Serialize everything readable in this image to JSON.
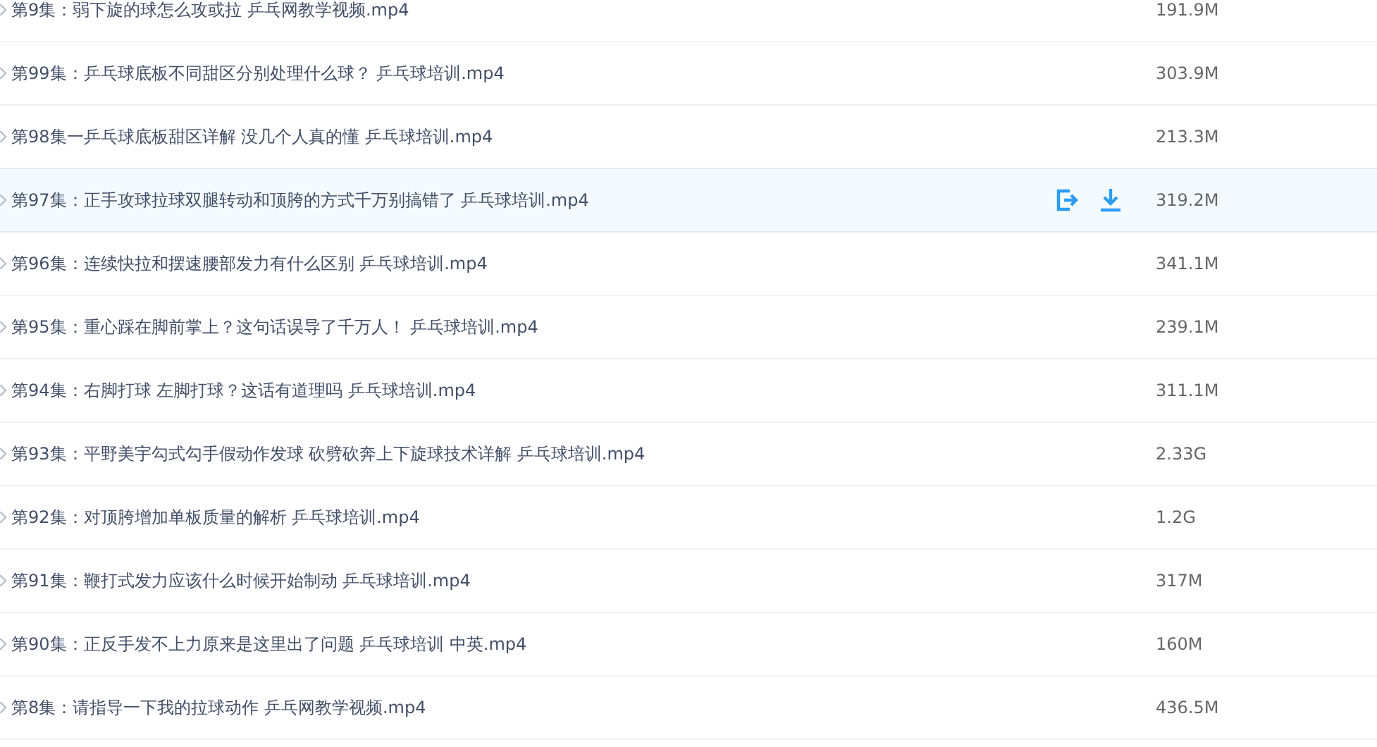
{
  "files": [
    {
      "name": "第9集：弱下旋的球怎么攻或拉 乒乓网教学视频.mp4",
      "size": "191.9M",
      "hovered": false
    },
    {
      "name": "第99集：乒乓球底板不同甜区分别处理什么球？ 乒乓球培训.mp4",
      "size": "303.9M",
      "hovered": false
    },
    {
      "name": "第98集一乒乓球底板甜区详解 没几个人真的懂 乒乓球培训.mp4",
      "size": "213.3M",
      "hovered": false
    },
    {
      "name": "第97集：正手攻球拉球双腿转动和顶胯的方式千万别搞错了 乒乓球培训.mp4",
      "size": "319.2M",
      "hovered": true
    },
    {
      "name": "第96集：连续快拉和摆速腰部发力有什么区别 乒乓球培训.mp4",
      "size": "341.1M",
      "hovered": false
    },
    {
      "name": "第95集：重心踩在脚前掌上？这句话误导了千万人！ 乒乓球培训.mp4",
      "size": "239.1M",
      "hovered": false
    },
    {
      "name": "第94集：右脚打球 左脚打球？这话有道理吗 乒乓球培训.mp4",
      "size": "311.1M",
      "hovered": false
    },
    {
      "name": "第93集：平野美宇勾式勾手假动作发球 砍劈砍奔上下旋球技术详解 乒乓球培训.mp4",
      "size": "2.33G",
      "hovered": false
    },
    {
      "name": "第92集：对顶胯增加单板质量的解析 乒乓球培训.mp4",
      "size": "1.2G",
      "hovered": false
    },
    {
      "name": "第91集：鞭打式发力应该什么时候开始制动 乒乓球培训.mp4",
      "size": "317M",
      "hovered": false
    },
    {
      "name": "第90集：正反手发不上力原来是这里出了问题 乒乓球培训 中英.mp4",
      "size": "160M",
      "hovered": false
    },
    {
      "name": "第8集：请指导一下我的拉球动作 乒乓网教学视频.mp4",
      "size": "436.5M",
      "hovered": false
    }
  ]
}
